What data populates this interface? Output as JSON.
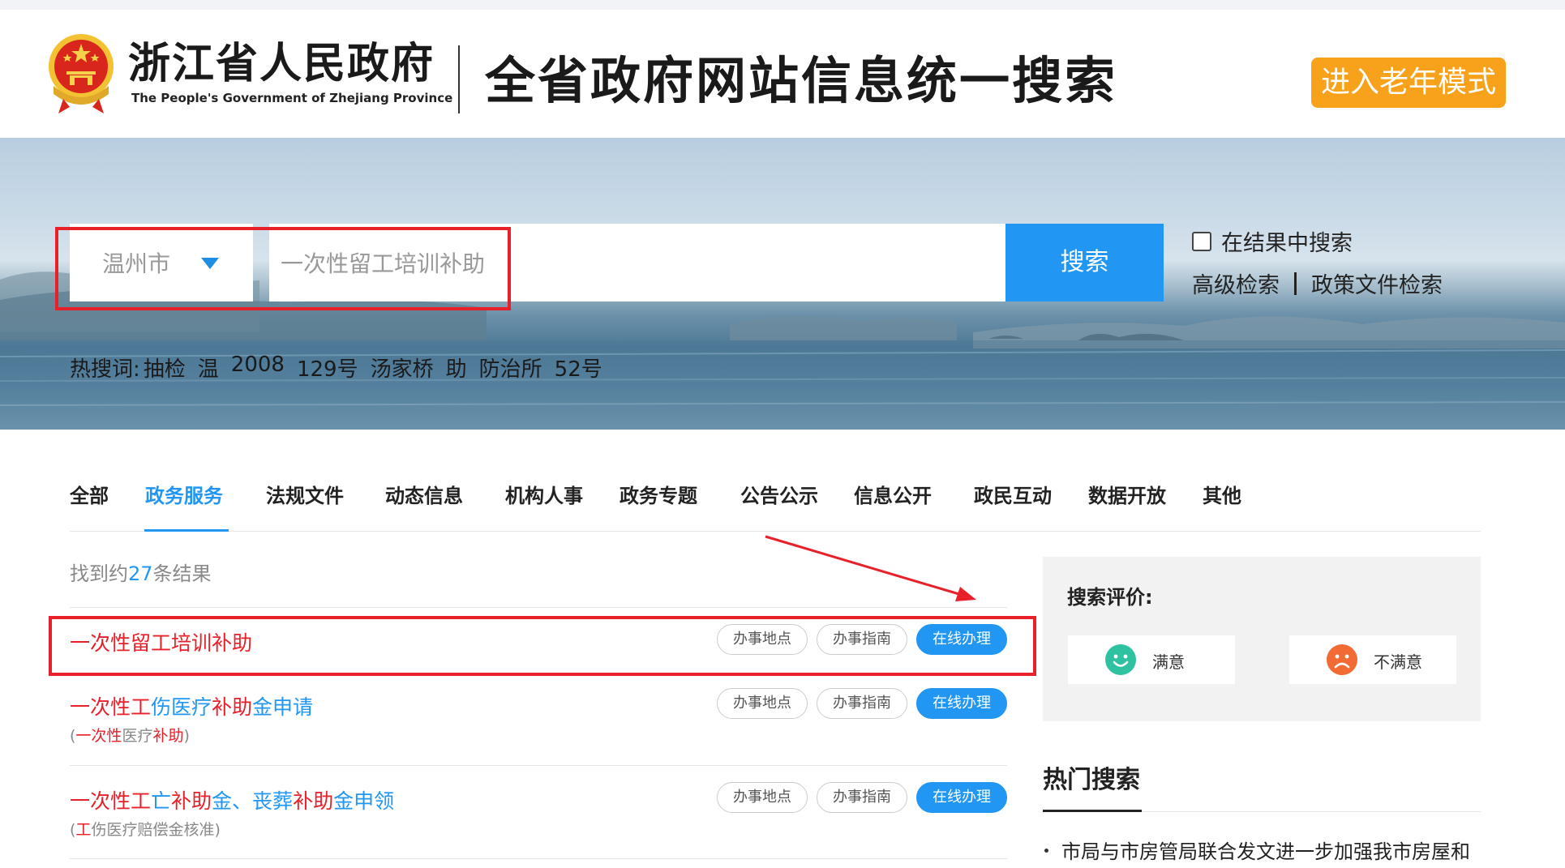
{
  "header": {
    "brand_cn": "浙江省人民政府",
    "brand_en": "The People's Government of Zhejiang Province",
    "site_title": "全省政府网站信息统一搜索",
    "elder_mode_label": "进入老年模式",
    "elder_color": "#f7a21a"
  },
  "search": {
    "city": "温州市",
    "query": "一次性留工培训补助",
    "button_label": "搜索",
    "in_result_label": "在结果中搜索",
    "advanced_label": "高级检索",
    "policy_label": "政策文件检索",
    "accent_color": "#2196f3"
  },
  "hotwords": {
    "label": "热搜词:",
    "items": [
      "抽检",
      "温",
      "2008",
      "129号",
      "汤家桥",
      "助",
      "防治所",
      "52号"
    ]
  },
  "tabs": {
    "items": [
      "全部",
      "政务服务",
      "法规文件",
      "动态信息",
      "机构人事",
      "政务专题",
      "公告公示",
      "信息公开",
      "政民互动",
      "数据开放",
      "其他"
    ],
    "active": "政务服务"
  },
  "results": {
    "count_prefix": "找到约",
    "count": "27",
    "count_suffix": "条结果",
    "action_labels": {
      "location": "办事地点",
      "guide": "办事指南",
      "online": "在线办理"
    },
    "items": [
      {
        "title_parts": [
          {
            "text": "一次性留工培训补助",
            "color": "red"
          }
        ]
      },
      {
        "title_parts": [
          {
            "text": "一次性工",
            "color": "red"
          },
          {
            "text": "伤医疗",
            "color": "blue"
          },
          {
            "text": "补助",
            "color": "red"
          },
          {
            "text": "金申请",
            "color": "blue"
          }
        ],
        "sub_parts": [
          {
            "text": "(",
            "color": "gray"
          },
          {
            "text": "一次性",
            "color": "red"
          },
          {
            "text": "医疗",
            "color": "gray"
          },
          {
            "text": "补助",
            "color": "red"
          },
          {
            "text": ")",
            "color": "gray"
          }
        ]
      },
      {
        "title_parts": [
          {
            "text": "一次性工",
            "color": "red"
          },
          {
            "text": "亡",
            "color": "blue"
          },
          {
            "text": "补助",
            "color": "red"
          },
          {
            "text": "金、丧葬",
            "color": "blue"
          },
          {
            "text": "补助",
            "color": "red"
          },
          {
            "text": "金申领",
            "color": "blue"
          }
        ],
        "sub_parts": [
          {
            "text": "(",
            "color": "gray"
          },
          {
            "text": "工",
            "color": "red"
          },
          {
            "text": "伤医疗赔偿金核准)",
            "color": "gray"
          }
        ]
      }
    ]
  },
  "sidebar": {
    "rating_title": "搜索评价:",
    "satisfied_label": "满意",
    "unsatisfied_label": "不满意",
    "satisfied_color": "#2fc2a0",
    "unsatisfied_color": "#f26b35",
    "hot_search_title": "热门搜索",
    "hot_items": [
      "市局与市房管局联合发文进一步加强我市房屋和"
    ]
  }
}
